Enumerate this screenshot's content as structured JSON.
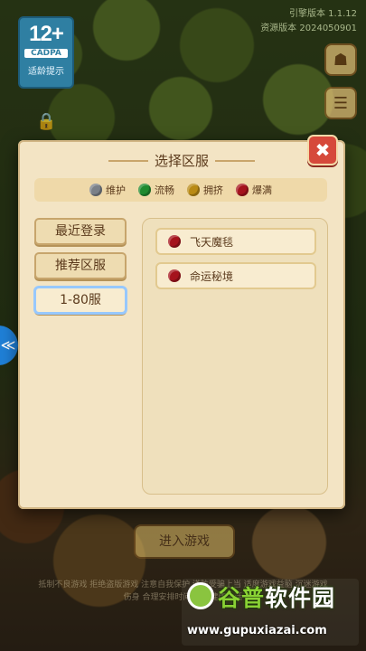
{
  "top": {
    "age_rating": "12+",
    "age_org": "CADPA",
    "age_tip": "适龄提示",
    "version_lines": [
      "引擎版本 1.1.12",
      "资源版本 2024050901"
    ]
  },
  "dialog": {
    "title": "选择区服",
    "close_glyph": "✖",
    "legend": [
      {
        "label": "维护",
        "color": "#7a8088"
      },
      {
        "label": "流畅",
        "color": "#1f8a2f"
      },
      {
        "label": "拥挤",
        "color": "#b98a14"
      },
      {
        "label": "爆满",
        "color": "#a5131d"
      }
    ],
    "tabs": [
      {
        "label": "最近登录",
        "active": false
      },
      {
        "label": "推荐区服",
        "active": false
      },
      {
        "label": "1-80服",
        "active": true
      }
    ],
    "servers": [
      {
        "name": "飞天魔毯",
        "status_color": "#a5131d"
      },
      {
        "name": "命运秘境",
        "status_color": "#a5131d"
      }
    ]
  },
  "bottom": {
    "enter_label": "进入游戏",
    "notice": "抵制不良游戏 拒绝盗版游戏 注意自我保护 谨防受骗上当 适度游戏益脑 沉迷游戏伤身 合理安排时间 享受健康生活"
  },
  "watermark": {
    "title_a": "谷普",
    "title_b": "软件园",
    "url": "www.gupuxiazai.com"
  }
}
